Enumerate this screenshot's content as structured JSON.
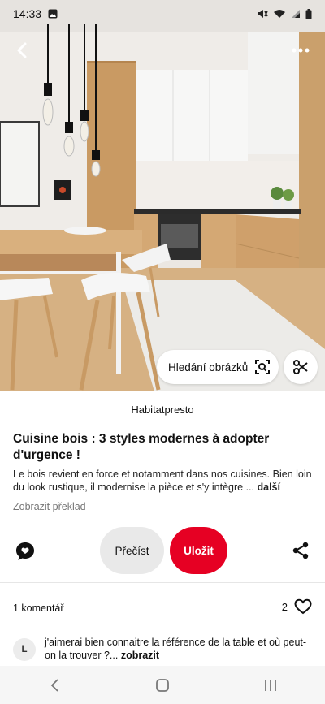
{
  "status": {
    "time": "14:33",
    "icons": [
      "image-notification-icon",
      "mute-icon",
      "wifi-icon",
      "signal-icon",
      "battery-icon"
    ]
  },
  "pin": {
    "visual_search_label": "Hledání obrázků",
    "source": "Habitatpresto",
    "title": "Cuisine bois : 3 styles modernes à adopter d'urgence !",
    "description": "Le bois revient en force et notamment dans nos cuisines. Bien loin du look rustique, il modernise la pièce et s'y intègre ...",
    "description_more": "další",
    "translate": "Zobrazit překlad"
  },
  "actions": {
    "read_label": "Přečíst",
    "save_label": "Uložit"
  },
  "comments": {
    "count_label": "1 komentář",
    "likes": "2",
    "items": [
      {
        "avatar_letter": "L",
        "text": "j'aimerai bien connaitre la référence de la table et où peut-on la trouver ?...",
        "show_more": "zobrazit"
      }
    ]
  },
  "colors": {
    "save": "#e60023",
    "read": "#e9e9e9",
    "nav_bg": "#f6f6f6"
  }
}
